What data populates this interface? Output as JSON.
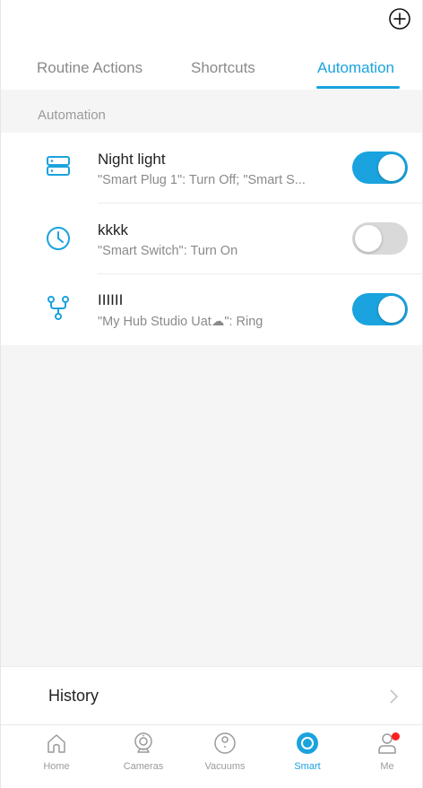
{
  "header": {
    "add_icon": "plus-circle-icon"
  },
  "tabs": [
    {
      "label": "Routine Actions",
      "active": false
    },
    {
      "label": "Shortcuts",
      "active": false
    },
    {
      "label": "Automation",
      "active": true
    }
  ],
  "section": {
    "label": "Automation"
  },
  "automations": [
    {
      "icon": "server-icon",
      "title": "Night light",
      "subtitle": "\"Smart Plug 1\": Turn Off; \"Smart S...",
      "enabled": true
    },
    {
      "icon": "clock-icon",
      "title": "kkkk",
      "subtitle": "\"Smart Switch\": Turn On",
      "enabled": false
    },
    {
      "icon": "hub-icon",
      "title": "IIIIII",
      "subtitle": "\"My Hub Studio Uat☁\": Ring",
      "enabled": true
    }
  ],
  "history": {
    "label": "History"
  },
  "bottom_nav": [
    {
      "label": "Home",
      "icon": "home-icon",
      "active": false
    },
    {
      "label": "Cameras",
      "icon": "camera-icon",
      "active": false
    },
    {
      "label": "Vacuums",
      "icon": "vacuum-icon",
      "active": false
    },
    {
      "label": "Smart",
      "icon": "smart-icon",
      "active": true
    },
    {
      "label": "Me",
      "icon": "person-icon",
      "active": false,
      "notification_dot": true
    }
  ],
  "colors": {
    "accent": "#1aa3de",
    "toggle_off": "#d9d9d9",
    "badge": "#ff1f1f"
  }
}
